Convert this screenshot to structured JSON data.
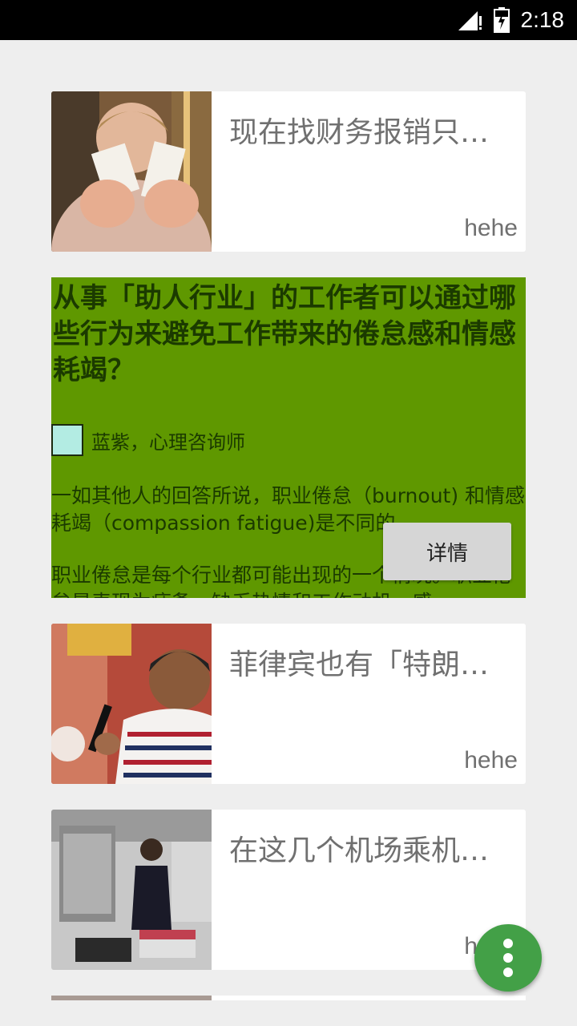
{
  "status": {
    "time": "2:18"
  },
  "cards": [
    {
      "title": "现在找财务报销只…",
      "author": "hehe",
      "thumb_icon": "person-holding-receipts-photo"
    },
    {
      "title": "菲律宾也有「特朗…",
      "author": "hehe",
      "thumb_icon": "man-with-microphone-photo"
    },
    {
      "title": "在这几个机场乘机…",
      "author": "hehe",
      "thumb_icon": "airport-luggage-photo"
    }
  ],
  "feature": {
    "title": "从事「助人行业」的工作者可以通过哪些行为来避免工作带来的倦怠感和情感耗竭？",
    "author": "蓝紫，心理咨询师",
    "paragraphs": [
      "一如其他人的回答所说，职业倦怠（burnout) 和情感耗竭（compassion fatigue)是不同的。",
      "职业倦怠是每个行业都可能出现的一个情况。职业倦怠是表现为疲惫，缺乏热情和工作动机，感"
    ],
    "detail_button": "详情",
    "bg_color": "#5f9800"
  },
  "fab": {
    "icon": "more-vert-icon",
    "color": "#43a047"
  }
}
